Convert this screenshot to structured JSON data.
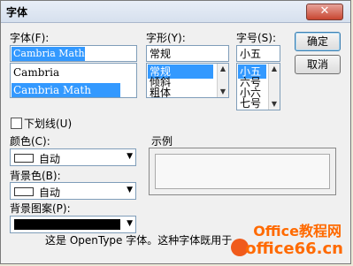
{
  "window": {
    "title": "字体",
    "close": "✕"
  },
  "font": {
    "label": "字体(F):",
    "value": "Cambria Math",
    "items": [
      "Cambria",
      "Cambria Math"
    ],
    "selected_index": 1
  },
  "style": {
    "label": "字形(Y):",
    "value": "常规",
    "items": [
      "常规",
      "倾斜",
      "粗体"
    ],
    "selected_index": 0
  },
  "size": {
    "label": "字号(S):",
    "value": "小五",
    "items": [
      "小五",
      "六号",
      "小六",
      "七号"
    ],
    "selected_index": 0
  },
  "buttons": {
    "ok": "确定",
    "cancel": "取消"
  },
  "underline": {
    "label": "下划线(U)"
  },
  "color": {
    "label": "颜色(C):",
    "value": "自动"
  },
  "bgcolor": {
    "label": "背景色(B):",
    "value": "自动"
  },
  "pattern": {
    "label": "背景图案(P):"
  },
  "preview": {
    "label": "示例"
  },
  "footer": {
    "text": "这是 OpenType 字体。这种字体既用于"
  },
  "watermark": {
    "text": "Office教程网",
    "url": "office66.cn"
  }
}
